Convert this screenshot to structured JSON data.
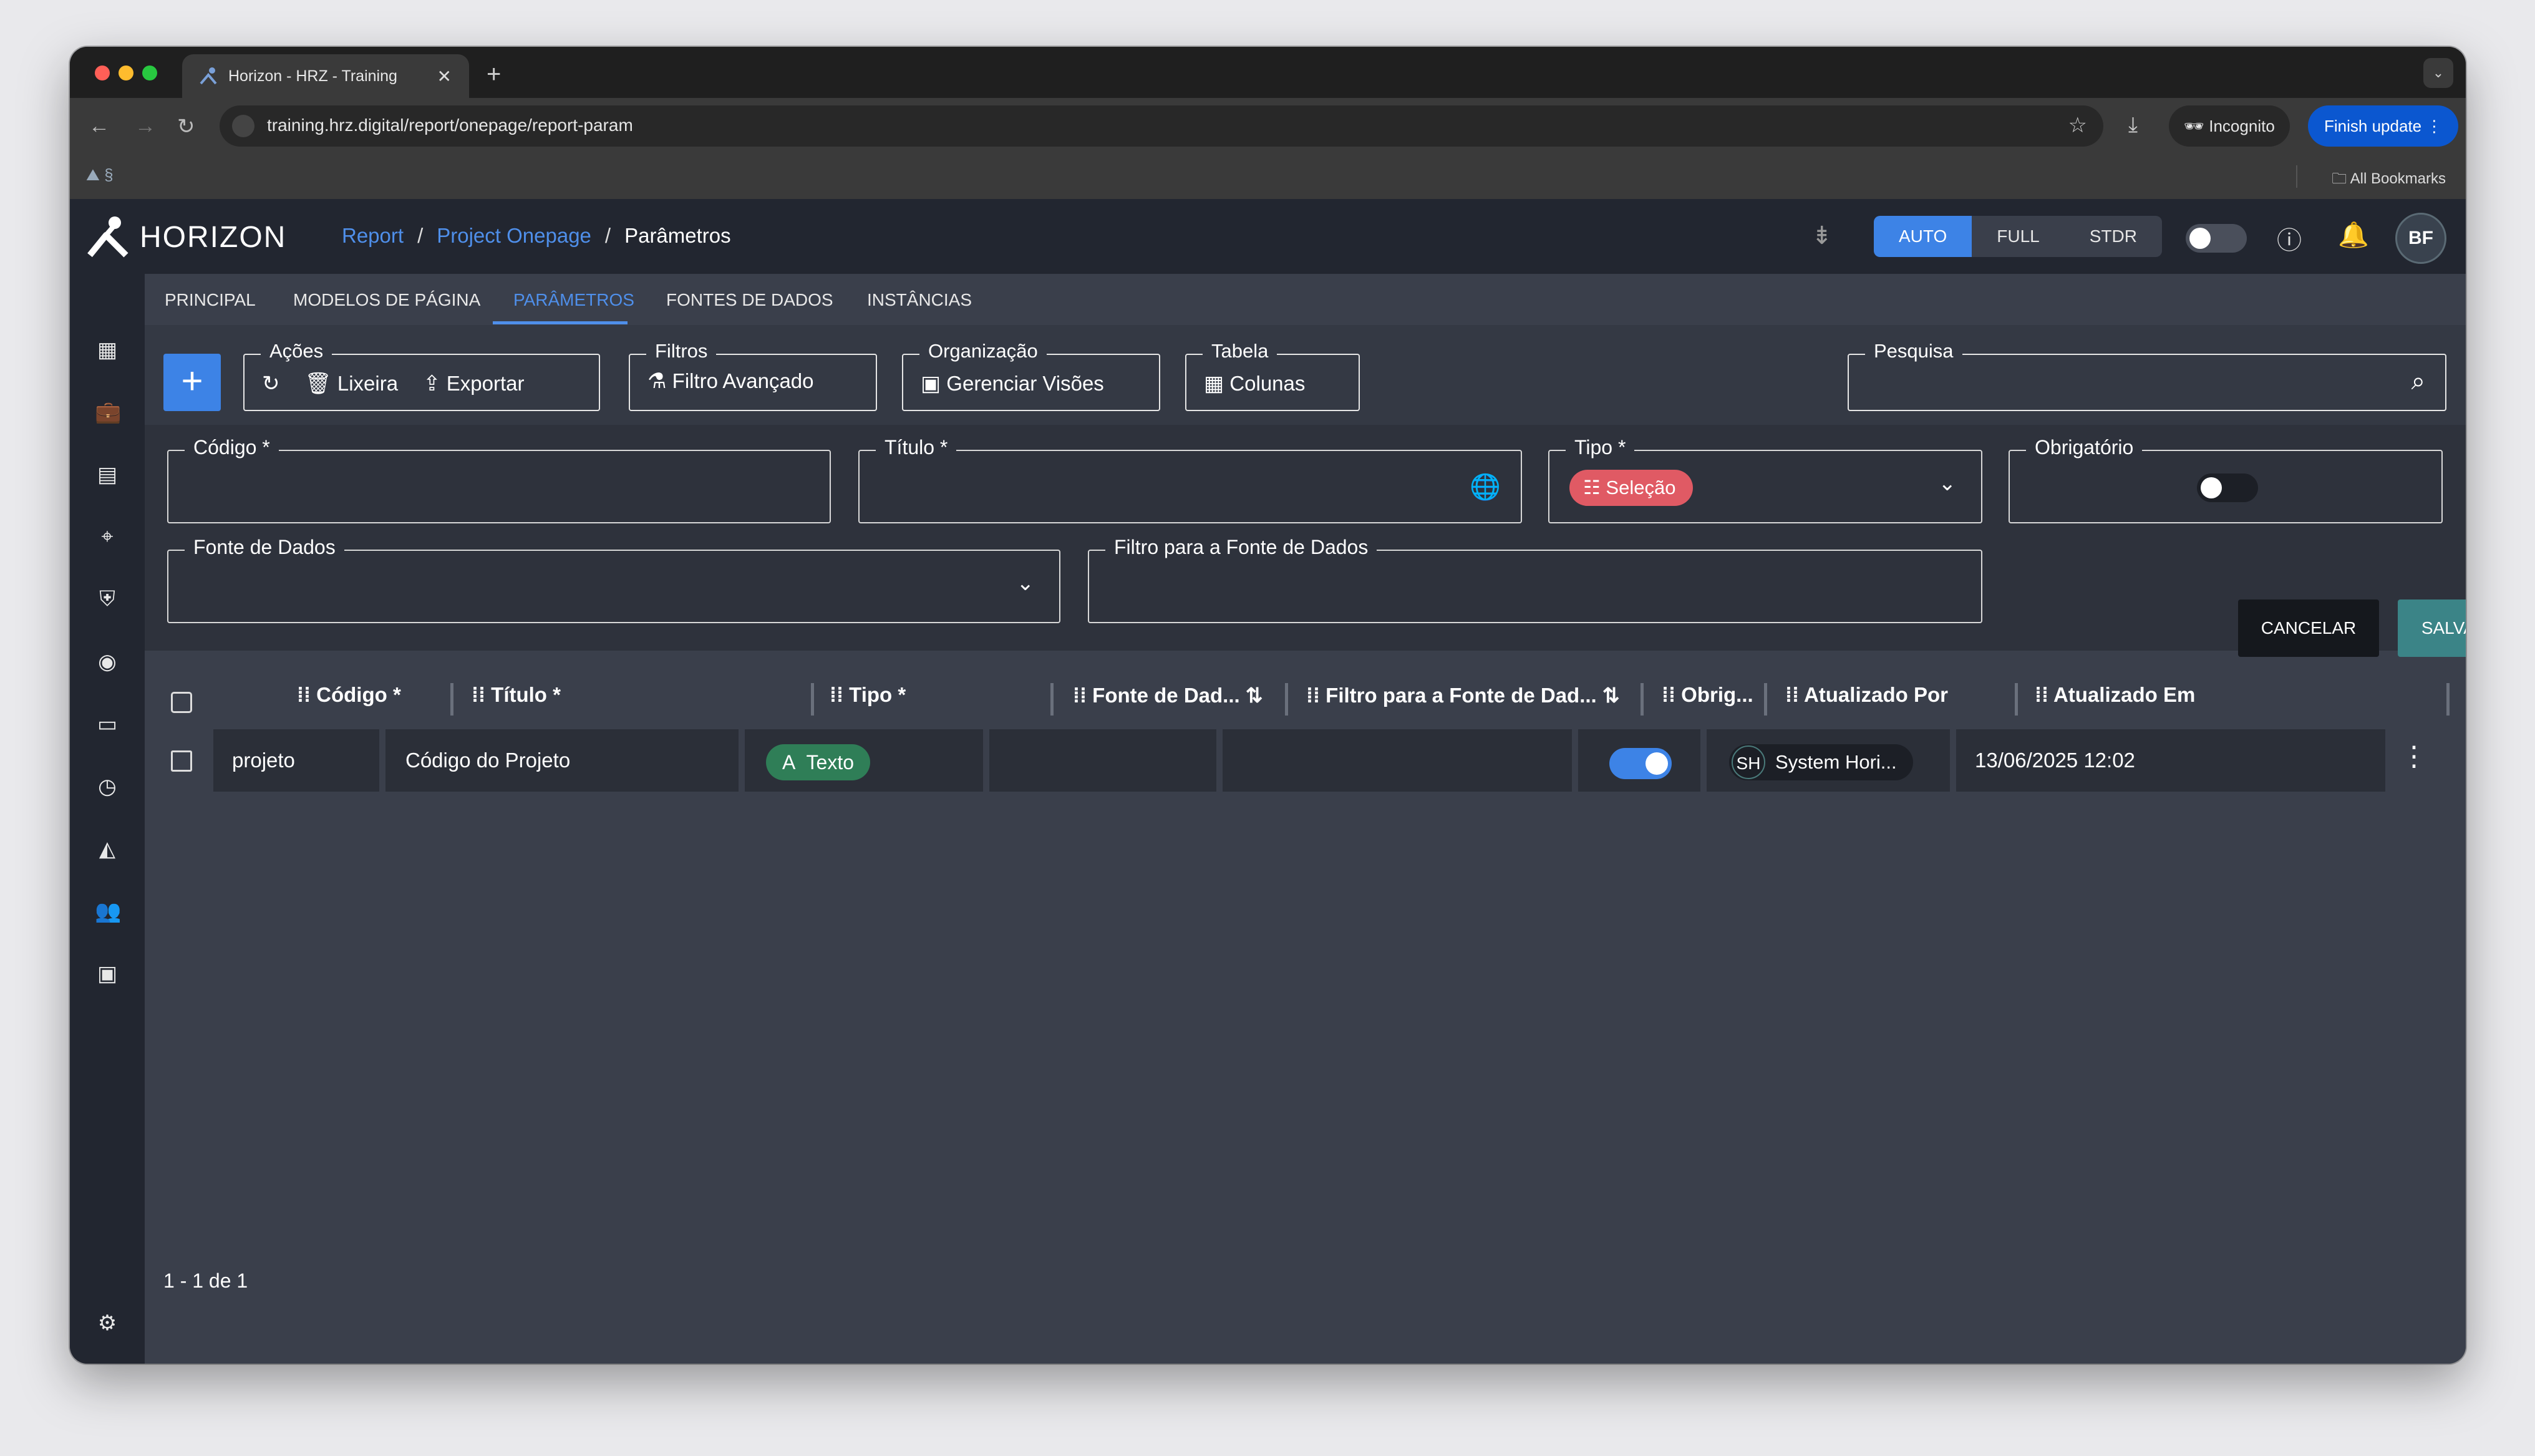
{
  "browser": {
    "tab_title": "Horizon - HRZ - Training",
    "url": "training.hrz.digital/report/onepage/report-param",
    "incognito_label": "Incognito",
    "finish_update_label": "Finish update",
    "bookmark_favicon_text": "§",
    "all_bookmarks_label": "All Bookmarks"
  },
  "header": {
    "logo_text": "HORIZON",
    "breadcrumb": [
      "Report",
      "Project Onepage",
      "Parâmetros"
    ],
    "density_modes": [
      "AUTO",
      "FULL",
      "STDR"
    ],
    "active_density": "AUTO",
    "avatar_initials": "BF"
  },
  "tabs": [
    "PRINCIPAL",
    "MODELOS DE PÁGINA",
    "PARÂMETROS",
    "FONTES DE DADOS",
    "INSTÂNCIAS"
  ],
  "active_tab": "PARÂMETROS",
  "toolbar": {
    "actions_legend": "Ações",
    "trash_label": "Lixeira",
    "export_label": "Exportar",
    "filters_legend": "Filtros",
    "advanced_filter_label": "Filtro Avançado",
    "organization_legend": "Organização",
    "manage_views_label": "Gerenciar Visões",
    "table_legend": "Tabela",
    "columns_label": "Colunas",
    "search_legend": "Pesquisa"
  },
  "form": {
    "codigo_label": "Código *",
    "codigo_value": "",
    "titulo_label": "Título *",
    "titulo_value": "",
    "tipo_label": "Tipo *",
    "tipo_value": "Seleção",
    "obrigatorio_label": "Obrigatório",
    "obrigatorio_value": false,
    "fonte_label": "Fonte de Dados",
    "filtro_label": "Filtro para a Fonte de Dados",
    "cancel_label": "CANCELAR",
    "save_label": "SALVAR"
  },
  "table": {
    "columns": [
      "Código *",
      "Título *",
      "Tipo *",
      "Fonte de Dad...",
      "Filtro para a Fonte de Dad...",
      "Obrig...",
      "Atualizado Por",
      "Atualizado Em"
    ],
    "rows": [
      {
        "codigo": "projeto",
        "titulo": "Código do Projeto",
        "tipo": "Texto",
        "fonte": "",
        "filtro": "",
        "obrigatorio": true,
        "atualizado_por_initials": "SH",
        "atualizado_por": "System Hori...",
        "atualizado_em": "13/06/2025 12:02"
      }
    ],
    "pagination": "1 - 1 de 1"
  },
  "colors": {
    "accent": "#3d83e6",
    "selecao_chip": "#e05a64",
    "texto_chip": "#2f7e57",
    "save_button": "#3b8487"
  }
}
